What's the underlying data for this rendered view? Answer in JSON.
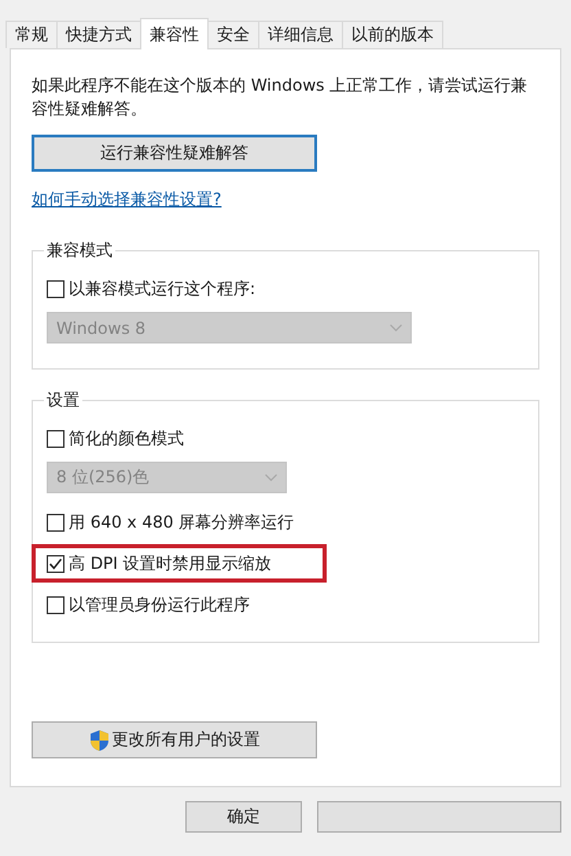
{
  "tabs": [
    {
      "label": "常规",
      "selected": false
    },
    {
      "label": "快捷方式",
      "selected": false
    },
    {
      "label": "兼容性",
      "selected": true
    },
    {
      "label": "安全",
      "selected": false
    },
    {
      "label": "详细信息",
      "selected": false
    },
    {
      "label": "以前的版本",
      "selected": false
    }
  ],
  "intro": "如果此程序不能在这个版本的 Windows 上正常工作，请尝试运行兼容性疑难解答。",
  "troubleshoot_button": "运行兼容性疑难解答",
  "help_link": "如何手动选择兼容性设置?",
  "groups": [
    {
      "title": "兼容模式",
      "items": [
        {
          "kind": "checkbox",
          "label": "以兼容模式运行这个程序:",
          "checked": false,
          "highlighted": false
        },
        {
          "kind": "dropdown",
          "value": "Windows 8"
        }
      ]
    },
    {
      "title": "设置",
      "items": [
        {
          "kind": "checkbox",
          "label": "简化的颜色模式",
          "checked": false,
          "highlighted": false
        },
        {
          "kind": "dropdown",
          "value": "8 位(256)色"
        },
        {
          "kind": "checkbox",
          "label": "用 640 x 480 屏幕分辨率运行",
          "checked": false,
          "highlighted": false
        },
        {
          "kind": "checkbox",
          "label": "高 DPI 设置时禁用显示缩放",
          "checked": true,
          "highlighted": true
        },
        {
          "kind": "checkbox",
          "label": "以管理员身份运行此程序",
          "checked": false,
          "highlighted": false
        }
      ]
    }
  ],
  "all_users_button": "更改所有用户的设置",
  "dialog_buttons": [
    {
      "kind": "labeled",
      "label": "确定"
    },
    {
      "kind": "covered"
    }
  ]
}
